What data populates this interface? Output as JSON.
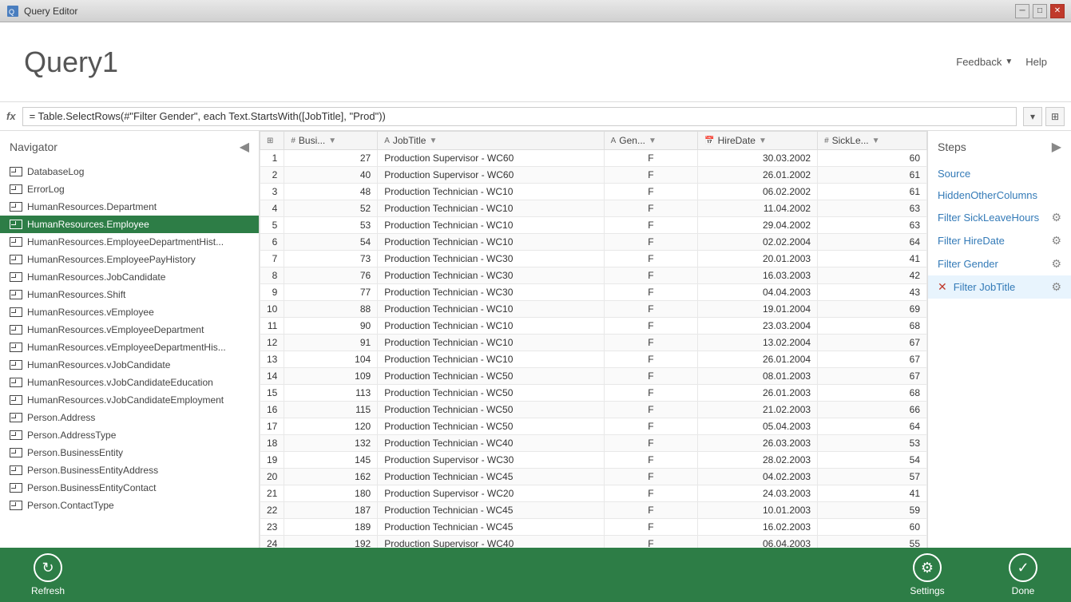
{
  "titleBar": {
    "title": "Query Editor",
    "iconText": "QE"
  },
  "header": {
    "title": "Query1",
    "feedback": "Feedback",
    "help": "Help"
  },
  "formulaBar": {
    "icon": "fx",
    "formula": "= Table.SelectRows(#\"Filter Gender\", each Text.StartsWith([JobTitle], \"Prod\"))"
  },
  "navigator": {
    "title": "Navigator",
    "items": [
      {
        "id": "DatabaseLog",
        "label": "DatabaseLog",
        "active": false
      },
      {
        "id": "ErrorLog",
        "label": "ErrorLog",
        "active": false
      },
      {
        "id": "HumanResources.Department",
        "label": "HumanResources.Department",
        "active": false
      },
      {
        "id": "HumanResources.Employee",
        "label": "HumanResources.Employee",
        "active": true
      },
      {
        "id": "HumanResources.EmployeeDepartmentHist...",
        "label": "HumanResources.EmployeeDepartmentHist...",
        "active": false
      },
      {
        "id": "HumanResources.EmployeePayHistory",
        "label": "HumanResources.EmployeePayHistory",
        "active": false
      },
      {
        "id": "HumanResources.JobCandidate",
        "label": "HumanResources.JobCandidate",
        "active": false
      },
      {
        "id": "HumanResources.Shift",
        "label": "HumanResources.Shift",
        "active": false
      },
      {
        "id": "HumanResources.vEmployee",
        "label": "HumanResources.vEmployee",
        "active": false
      },
      {
        "id": "HumanResources.vEmployeeDepartment",
        "label": "HumanResources.vEmployeeDepartment",
        "active": false
      },
      {
        "id": "HumanResources.vEmployeeDepartmentHis...",
        "label": "HumanResources.vEmployeeDepartmentHis...",
        "active": false
      },
      {
        "id": "HumanResources.vJobCandidate",
        "label": "HumanResources.vJobCandidate",
        "active": false
      },
      {
        "id": "HumanResources.vJobCandidateEducation",
        "label": "HumanResources.vJobCandidateEducation",
        "active": false
      },
      {
        "id": "HumanResources.vJobCandidateEmployment",
        "label": "HumanResources.vJobCandidateEmployment",
        "active": false
      },
      {
        "id": "Person.Address",
        "label": "Person.Address",
        "active": false
      },
      {
        "id": "Person.AddressType",
        "label": "Person.AddressType",
        "active": false
      },
      {
        "id": "Person.BusinessEntity",
        "label": "Person.BusinessEntity",
        "active": false
      },
      {
        "id": "Person.BusinessEntityAddress",
        "label": "Person.BusinessEntityAddress",
        "active": false
      },
      {
        "id": "Person.BusinessEntityContact",
        "label": "Person.BusinessEntityContact",
        "active": false
      },
      {
        "id": "Person.ContactType",
        "label": "Person.ContactType",
        "active": false
      }
    ]
  },
  "table": {
    "columns": [
      {
        "id": "busi",
        "label": "Busi...",
        "type": "num"
      },
      {
        "id": "jobtitle",
        "label": "JobTitle",
        "type": "text",
        "filtered": true
      },
      {
        "id": "gender",
        "label": "Gen...",
        "type": "text",
        "filtered": true
      },
      {
        "id": "hiredate",
        "label": "HireDate",
        "type": "date",
        "filtered": true
      },
      {
        "id": "sickle",
        "label": "SickLe...",
        "type": "num",
        "filtered": true
      }
    ],
    "rows": [
      {
        "num": 1,
        "busi": 27,
        "jobtitle": "Production Supervisor - WC60",
        "gender": "F",
        "hiredate": "30.03.2002",
        "sickle": 60
      },
      {
        "num": 2,
        "busi": 40,
        "jobtitle": "Production Supervisor - WC60",
        "gender": "F",
        "hiredate": "26.01.2002",
        "sickle": 61
      },
      {
        "num": 3,
        "busi": 48,
        "jobtitle": "Production Technician - WC10",
        "gender": "F",
        "hiredate": "06.02.2002",
        "sickle": 61
      },
      {
        "num": 4,
        "busi": 52,
        "jobtitle": "Production Technician - WC10",
        "gender": "F",
        "hiredate": "11.04.2002",
        "sickle": 63
      },
      {
        "num": 5,
        "busi": 53,
        "jobtitle": "Production Technician - WC10",
        "gender": "F",
        "hiredate": "29.04.2002",
        "sickle": 63
      },
      {
        "num": 6,
        "busi": 54,
        "jobtitle": "Production Technician - WC10",
        "gender": "F",
        "hiredate": "02.02.2004",
        "sickle": 64
      },
      {
        "num": 7,
        "busi": 73,
        "jobtitle": "Production Technician - WC30",
        "gender": "F",
        "hiredate": "20.01.2003",
        "sickle": 41
      },
      {
        "num": 8,
        "busi": 76,
        "jobtitle": "Production Technician - WC30",
        "gender": "F",
        "hiredate": "16.03.2003",
        "sickle": 42
      },
      {
        "num": 9,
        "busi": 77,
        "jobtitle": "Production Technician - WC30",
        "gender": "F",
        "hiredate": "04.04.2003",
        "sickle": 43
      },
      {
        "num": 10,
        "busi": 88,
        "jobtitle": "Production Technician - WC10",
        "gender": "F",
        "hiredate": "19.01.2004",
        "sickle": 69
      },
      {
        "num": 11,
        "busi": 90,
        "jobtitle": "Production Technician - WC10",
        "gender": "F",
        "hiredate": "23.03.2004",
        "sickle": 68
      },
      {
        "num": 12,
        "busi": 91,
        "jobtitle": "Production Technician - WC10",
        "gender": "F",
        "hiredate": "13.02.2004",
        "sickle": 67
      },
      {
        "num": 13,
        "busi": 104,
        "jobtitle": "Production Technician - WC10",
        "gender": "F",
        "hiredate": "26.01.2004",
        "sickle": 67
      },
      {
        "num": 14,
        "busi": 109,
        "jobtitle": "Production Technician - WC50",
        "gender": "F",
        "hiredate": "08.01.2003",
        "sickle": 67
      },
      {
        "num": 15,
        "busi": 113,
        "jobtitle": "Production Technician - WC50",
        "gender": "F",
        "hiredate": "26.01.2003",
        "sickle": 68
      },
      {
        "num": 16,
        "busi": 115,
        "jobtitle": "Production Technician - WC50",
        "gender": "F",
        "hiredate": "21.02.2003",
        "sickle": 66
      },
      {
        "num": 17,
        "busi": 120,
        "jobtitle": "Production Technician - WC50",
        "gender": "F",
        "hiredate": "05.04.2003",
        "sickle": 64
      },
      {
        "num": 18,
        "busi": 132,
        "jobtitle": "Production Technician - WC40",
        "gender": "F",
        "hiredate": "26.03.2003",
        "sickle": 53
      },
      {
        "num": 19,
        "busi": 145,
        "jobtitle": "Production Supervisor - WC30",
        "gender": "F",
        "hiredate": "28.02.2003",
        "sickle": 54
      },
      {
        "num": 20,
        "busi": 162,
        "jobtitle": "Production Technician - WC45",
        "gender": "F",
        "hiredate": "04.02.2003",
        "sickle": 57
      },
      {
        "num": 21,
        "busi": 180,
        "jobtitle": "Production Supervisor - WC20",
        "gender": "F",
        "hiredate": "24.03.2003",
        "sickle": 41
      },
      {
        "num": 22,
        "busi": 187,
        "jobtitle": "Production Technician - WC45",
        "gender": "F",
        "hiredate": "10.01.2003",
        "sickle": 59
      },
      {
        "num": 23,
        "busi": 189,
        "jobtitle": "Production Technician - WC45",
        "gender": "F",
        "hiredate": "16.02.2003",
        "sickle": 60
      },
      {
        "num": 24,
        "busi": 192,
        "jobtitle": "Production Supervisor - WC40",
        "gender": "F",
        "hiredate": "06.04.2003",
        "sickle": 55
      }
    ]
  },
  "steps": {
    "title": "Steps",
    "items": [
      {
        "id": "source",
        "label": "Source",
        "hasGear": false,
        "hasDelete": false,
        "isError": false
      },
      {
        "id": "hiddenOtherColumns",
        "label": "HiddenOtherColumns",
        "hasGear": false,
        "hasDelete": false,
        "isError": false
      },
      {
        "id": "filterSickLeaveHours",
        "label": "Filter SickLeaveHours",
        "hasGear": true,
        "hasDelete": false,
        "isError": false
      },
      {
        "id": "filterHireDate",
        "label": "Filter HireDate",
        "hasGear": true,
        "hasDelete": false,
        "isError": false
      },
      {
        "id": "filterGender",
        "label": "Filter Gender",
        "hasGear": true,
        "hasDelete": false,
        "isError": false
      },
      {
        "id": "filterJobTitle",
        "label": "Filter JobTitle",
        "hasGear": true,
        "hasDelete": false,
        "isError": false,
        "isActive": true,
        "hasX": true
      }
    ]
  },
  "bottomBar": {
    "refreshLabel": "Refresh",
    "settingsLabel": "Settings",
    "doneLabel": "Done"
  }
}
